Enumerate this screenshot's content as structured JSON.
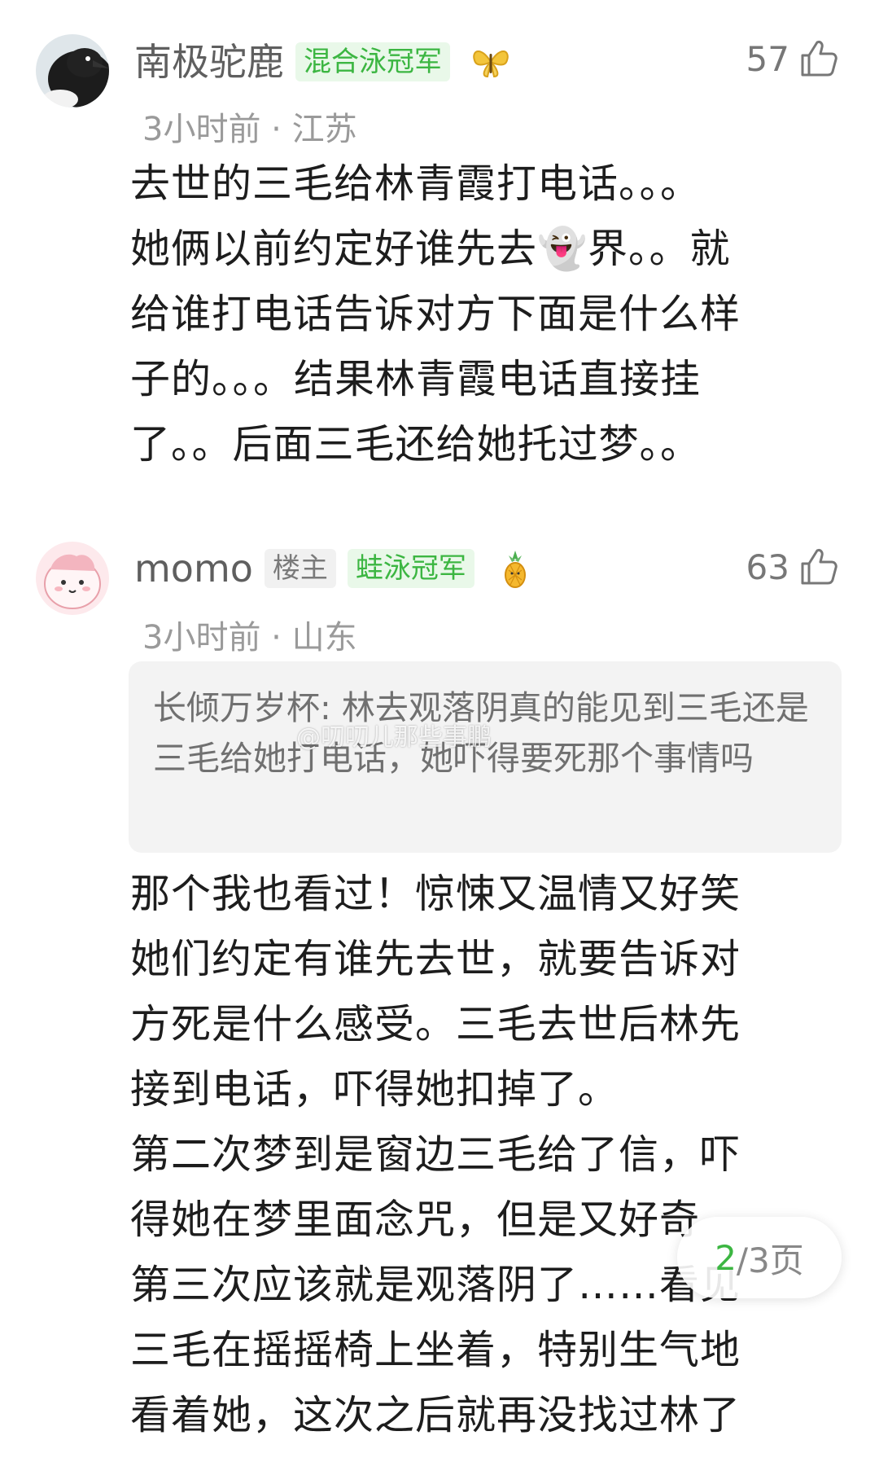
{
  "comments": [
    {
      "username": "南极驼鹿",
      "badges": [
        "混合泳冠军"
      ],
      "badge_icon": "butterfly-icon",
      "meta": "3小时前 · 江苏",
      "likes": "57",
      "lines": [
        "去世的三毛给林青霞打电话。。。",
        "她俩以前约定好谁先去👻界。。就",
        "给谁打电话告诉对方下面是什么样",
        "子的。。。结果林青霞电话直接挂",
        "了。。后面三毛还给她托过梦。。"
      ]
    },
    {
      "username": "momo",
      "owner_tag": "楼主",
      "badges": [
        "蛙泳冠军"
      ],
      "badge_icon": "pineapple-icon",
      "meta": "3小时前 · 山东",
      "likes": "63",
      "quote": "长倾万岁杯: 林去观落阴真的能见到三毛还是三毛给她打电话，她吓得要死那个事情吗",
      "lines": [
        "那个我也看过！惊悚又温情又好笑",
        "她们约定有谁先去世，就要告诉对",
        "方死是什么感受。三毛去世后林先",
        "接到电话，吓得她扣掉了。",
        "第二次梦到是窗边三毛给了信，吓",
        "得她在梦里面念咒，但是又好奇",
        "第三次应该就是观落阴了……看见",
        "三毛在摇摇椅上坐着，特别生气地",
        "看着她，这次之后就再没找过林了"
      ]
    }
  ],
  "watermark": "@叨叨儿那些事鹏",
  "pager": {
    "current": "2",
    "total": "/3页"
  },
  "colors": {
    "accent_green": "#3cb642",
    "badge_bg": "#e9f8e9"
  }
}
